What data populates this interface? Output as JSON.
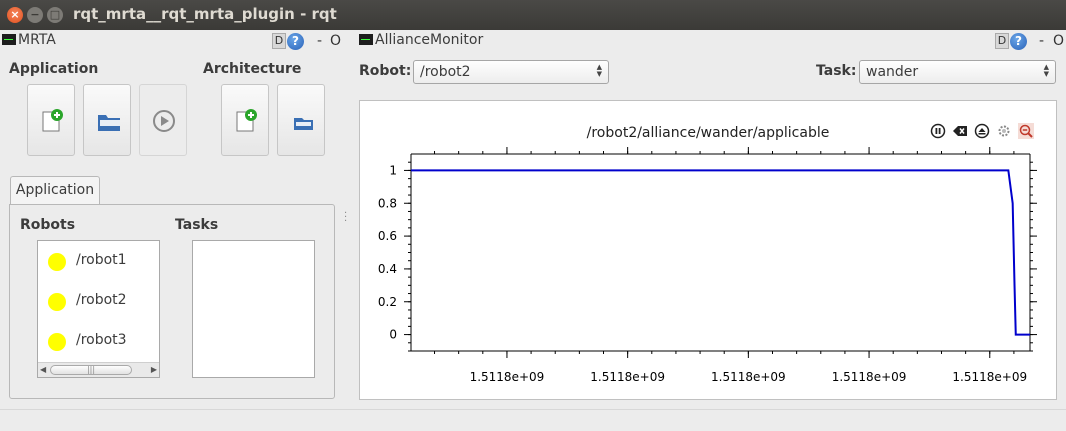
{
  "window": {
    "title": "rqt_mrta__rqt_mrta_plugin - rqt",
    "close_glyph": "×",
    "min_glyph": "−",
    "max_glyph": "□"
  },
  "mrta_dock": {
    "title": "MRTA",
    "d_label": "D",
    "help_label": "?",
    "min_label": "-",
    "close_label": "O",
    "application_label": "Application",
    "architecture_label": "Architecture",
    "tab_label": "Application",
    "robots_label": "Robots",
    "tasks_label": "Tasks",
    "robots": [
      {
        "label": "/robot1",
        "status_color": "#ffff00"
      },
      {
        "label": "/robot2",
        "status_color": "#ffff00"
      },
      {
        "label": "/robot3",
        "status_color": "#ffff00"
      }
    ],
    "scroll_thumb_glyph": "|||"
  },
  "alliance_dock": {
    "title": "AllianceMonitor",
    "d_label": "D",
    "help_label": "?",
    "min_label": "-",
    "close_label": "O",
    "robot_label": "Robot:",
    "robot_value": "/robot2",
    "task_label": "Task:",
    "task_value": "wander",
    "plot_title": "/robot2/alliance/wander/applicable"
  },
  "chart_data": {
    "type": "line",
    "title": "/robot2/alliance/wander/applicable",
    "xlabel": "",
    "ylabel": "",
    "y_ticks": [
      "1",
      "0.8",
      "0.6",
      "0.4",
      "0.2",
      "0"
    ],
    "x_ticks": [
      "1.5118e+09",
      "1.5118e+09",
      "1.5118e+09",
      "1.5118e+09",
      "1.5118e+09"
    ],
    "ylim": [
      -0.1,
      1.1
    ],
    "series": [
      {
        "color": "#0000cc",
        "x": [
          0,
          0.965,
          0.972,
          0.975,
          0.977,
          0.979,
          1.0
        ],
        "y": [
          1,
          1,
          0.8,
          0.3,
          0,
          0,
          0
        ]
      }
    ],
    "grid": false
  },
  "colors": {
    "accent_close": "#e0501e",
    "plot_line": "#0000cc",
    "status_dot": "#ffff00"
  }
}
